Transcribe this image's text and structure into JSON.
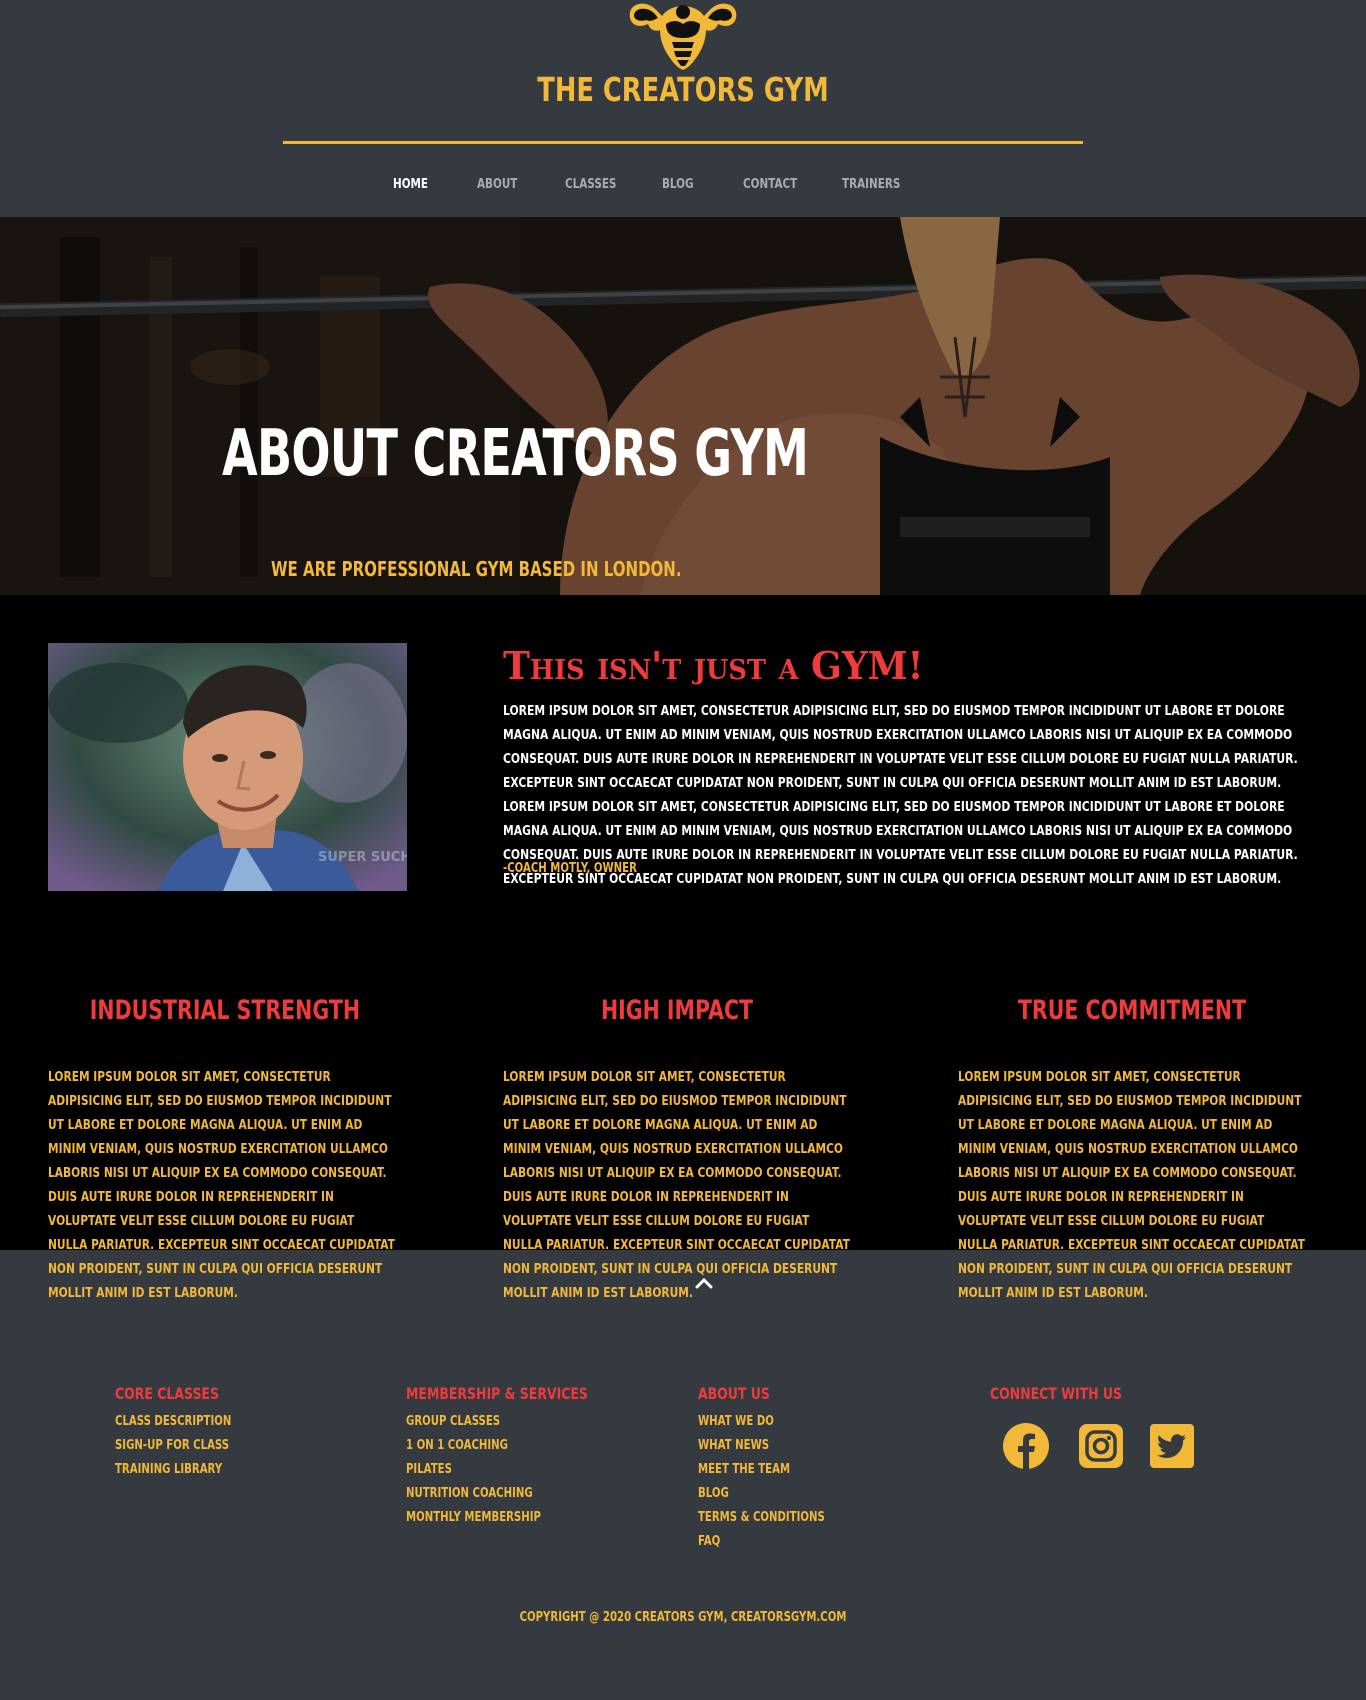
{
  "brand": {
    "name": "THE CREATORS GYM",
    "accent": "#f2b838",
    "red": "#ef3b3b",
    "background": "#343a40"
  },
  "nav": {
    "items": [
      {
        "label": "HOME",
        "active": true
      },
      {
        "label": "ABOUT"
      },
      {
        "label": "CLASSES"
      },
      {
        "label": "BLOG"
      },
      {
        "label": "CONTACT"
      },
      {
        "label": "TRAINERS"
      }
    ]
  },
  "hero": {
    "title": "ABOUT CREATORS GYM",
    "subtitle": "WE ARE PROFESSIONAL GYM BASED IN LONDON."
  },
  "about": {
    "heading": "This isn't just a GYM!",
    "body": "LOREM IPSUM DOLOR SIT AMET, CONSECTETUR ADIPISICING ELIT, SED DO EIUSMOD TEMPOR INCIDIDUNT UT LABORE ET DOLORE MAGNA ALIQUA. UT ENIM AD MINIM VENIAM, QUIS NOSTRUD EXERCITATION ULLAMCO LABORIS NISI UT ALIQUIP EX EA COMMODO CONSEQUAT. DUIS AUTE IRURE DOLOR IN REPREHENDERIT IN VOLUPTATE VELIT ESSE CILLUM DOLORE EU FUGIAT NULLA PARIATUR. EXCEPTEUR SINT OCCAECAT CUPIDATAT NON PROIDENT, SUNT IN CULPA QUI OFFICIA DESERUNT MOLLIT ANIM ID EST LABORUM. LOREM IPSUM DOLOR SIT AMET, CONSECTETUR ADIPISICING ELIT, SED DO EIUSMOD TEMPOR INCIDIDUNT UT LABORE ET DOLORE MAGNA ALIQUA. UT ENIM AD MINIM VENIAM, QUIS NOSTRUD EXERCITATION ULLAMCO LABORIS NISI UT ALIQUIP EX EA COMMODO CONSEQUAT. DUIS AUTE IRURE DOLOR IN REPREHENDERIT IN VOLUPTATE VELIT ESSE CILLUM DOLORE EU FUGIAT NULLA PARIATUR. EXCEPTEUR SINT OCCAECAT CUPIDATAT NON PROIDENT, SUNT IN CULPA QUI OFFICIA DESERUNT MOLLIT ANIM ID EST LABORUM.",
    "signature": "-COACH MOTLY, OWNER",
    "portrait_watermark": "SUPER SUCHOS"
  },
  "features": [
    {
      "title": "INDUSTRIAL STRENGTH",
      "text": "LOREM IPSUM DOLOR SIT AMET, CONSECTETUR ADIPISICING ELIT, SED DO EIUSMOD TEMPOR INCIDIDUNT UT LABORE ET DOLORE MAGNA ALIQUA. UT ENIM AD MINIM VENIAM, QUIS NOSTRUD EXERCITATION ULLAMCO LABORIS NISI UT ALIQUIP EX EA COMMODO CONSEQUAT. DUIS AUTE IRURE DOLOR IN REPREHENDERIT IN VOLUPTATE VELIT ESSE CILLUM DOLORE EU FUGIAT NULLA PARIATUR. EXCEPTEUR SINT OCCAECAT CUPIDATAT NON PROIDENT, SUNT IN CULPA QUI OFFICIA DESERUNT MOLLIT ANIM ID EST LABORUM."
    },
    {
      "title": "HIGH IMPACT",
      "text": "LOREM IPSUM DOLOR SIT AMET, CONSECTETUR ADIPISICING ELIT, SED DO EIUSMOD TEMPOR INCIDIDUNT UT LABORE ET DOLORE MAGNA ALIQUA. UT ENIM AD MINIM VENIAM, QUIS NOSTRUD EXERCITATION ULLAMCO LABORIS NISI UT ALIQUIP EX EA COMMODO CONSEQUAT. DUIS AUTE IRURE DOLOR IN REPREHENDERIT IN VOLUPTATE VELIT ESSE CILLUM DOLORE EU FUGIAT NULLA PARIATUR. EXCEPTEUR SINT OCCAECAT CUPIDATAT NON PROIDENT, SUNT IN CULPA QUI OFFICIA DESERUNT MOLLIT ANIM ID EST LABORUM."
    },
    {
      "title": "TRUE COMMITMENT",
      "text": "LOREM IPSUM DOLOR SIT AMET, CONSECTETUR ADIPISICING ELIT, SED DO EIUSMOD TEMPOR INCIDIDUNT UT LABORE ET DOLORE MAGNA ALIQUA. UT ENIM AD MINIM VENIAM, QUIS NOSTRUD EXERCITATION ULLAMCO LABORIS NISI UT ALIQUIP EX EA COMMODO CONSEQUAT. DUIS AUTE IRURE DOLOR IN REPREHENDERIT IN VOLUPTATE VELIT ESSE CILLUM DOLORE EU FUGIAT NULLA PARIATUR. EXCEPTEUR SINT OCCAECAT CUPIDATAT NON PROIDENT, SUNT IN CULPA QUI OFFICIA DESERUNT MOLLIT ANIM ID EST LABORUM."
    }
  ],
  "footer": {
    "columns": [
      {
        "heading": "CORE CLASSES",
        "links": [
          "CLASS DESCRIPTION",
          "SIGN-UP FOR CLASS",
          "TRAINING LIBRARY"
        ]
      },
      {
        "heading": "MEMBERSHIP & SERVICES",
        "links": [
          "GROUP CLASSES",
          "1 ON 1 COACHING",
          "PILATES",
          "NUTRITION COACHING",
          "MONTHLY MEMBERSHIP"
        ]
      },
      {
        "heading": "ABOUT US",
        "links": [
          "WHAT WE DO",
          "WHAT NEWS",
          "MEET THE TEAM",
          "BLOG",
          "TERMS & CONDITIONS",
          "FAQ"
        ]
      },
      {
        "heading": "CONNECT WITH US",
        "links": []
      }
    ],
    "social_icons": [
      "facebook-icon",
      "instagram-icon",
      "twitter-icon"
    ],
    "copyright": "COPYRIGHT @ 2020 CREATORS GYM, CREATORSGYM.COM"
  }
}
